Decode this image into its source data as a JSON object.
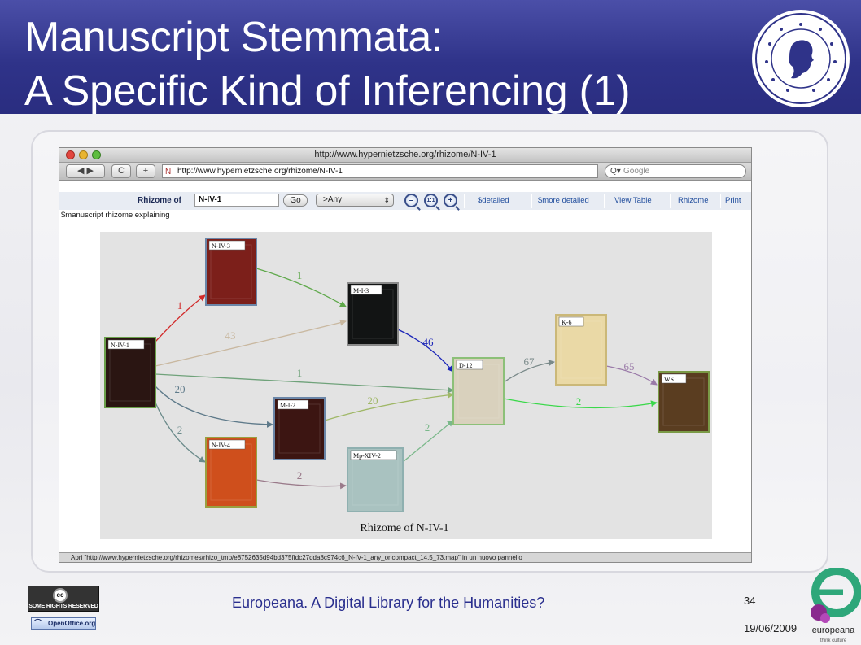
{
  "slide": {
    "title_line1": "Manuscript Stemmata:",
    "title_line2": "A Specific Kind of Inferencing (1)",
    "footer_text": "Europeana. A Digital Library for the Humanities?",
    "page_number": "34",
    "date": "19/06/2009",
    "cc_label": "SOME RIGHTS RESERVED",
    "openoffice_label": "OpenOffice.org",
    "europeana_logo_label": "europeana",
    "europeana_logo_sublabel": "think culture"
  },
  "browser": {
    "window_title": "http://www.hypernietzsche.org/rhizome/N-IV-1",
    "back_forward": "◀ ▶",
    "reload": "C",
    "add": "+",
    "url": "http://www.hypernietzsche.org/rhizome/N-IV-1",
    "search_placeholder": "Google",
    "status_bar": "Apri \"http://www.hypernietzsche.org/rhizomes/rhizo_tmp/e8752635d94bd375ffdc27dda8c974c6_N-IV-1_any_oncompact_14.5_73.map\" in un nuovo pannello"
  },
  "page": {
    "rhizome_label": "Rhizome of",
    "rhizome_value": "N-IV-1",
    "go_label": "Go",
    "filter_value": ">Any",
    "zoom_out": "–",
    "zoom_reset": "1:1",
    "zoom_in": "+",
    "nav_links": [
      "$detailed",
      "$more detailed",
      "View Table",
      "Rhizome",
      "Print"
    ],
    "explain_text": "$manuscript rhizome explaining"
  },
  "graph": {
    "caption": "Rhizome of N-IV-1",
    "nodes": [
      {
        "id": "N-IV-1",
        "cover": "#2a1512",
        "border": "#6aa04a"
      },
      {
        "id": "N-IV-3",
        "cover": "#7c1f1a",
        "border": "#6b86a8"
      },
      {
        "id": "M-I-3",
        "cover": "#121414",
        "border": "#8a8a8a"
      },
      {
        "id": "M-I-2",
        "cover": "#3c1512",
        "border": "#6b86a8"
      },
      {
        "id": "N-IV-4",
        "cover": "#cf4f1c",
        "border": "#9aa040"
      },
      {
        "id": "Mp-XIV-2",
        "cover": "#a9c2c0",
        "border": "#8fb0b0"
      },
      {
        "id": "D-12",
        "cover": "#d9d1bd",
        "border": "#8cc078"
      },
      {
        "id": "K-6",
        "cover": "#ead9a6",
        "border": "#cbb878"
      },
      {
        "id": "WS",
        "cover": "#5a3d20",
        "border": "#7a9a46"
      }
    ],
    "edges": [
      {
        "from": "N-IV-1",
        "to": "N-IV-3",
        "label": "1",
        "color": "#d22a2a"
      },
      {
        "from": "N-IV-3",
        "to": "M-I-3",
        "label": "1",
        "color": "#5ea84a"
      },
      {
        "from": "N-IV-1",
        "to": "M-I-3",
        "label": "43",
        "color": "#c9b8a0"
      },
      {
        "from": "M-I-3",
        "to": "D-12",
        "label": "46",
        "color": "#1a24b8"
      },
      {
        "from": "N-IV-1",
        "to": "D-12",
        "label": "1",
        "color": "#6fa27a"
      },
      {
        "from": "N-IV-1",
        "to": "M-I-2",
        "label": "20",
        "color": "#5e7a8a"
      },
      {
        "from": "M-I-2",
        "to": "D-12",
        "label": "20",
        "color": "#a0b868"
      },
      {
        "from": "N-IV-1",
        "to": "N-IV-4",
        "label": "2",
        "color": "#6a8a8a"
      },
      {
        "from": "N-IV-4",
        "to": "Mp-XIV-2",
        "label": "2",
        "color": "#9a7a8a"
      },
      {
        "from": "Mp-XIV-2",
        "to": "D-12",
        "label": "2",
        "color": "#7ab88a"
      },
      {
        "from": "D-12",
        "to": "K-6",
        "label": "67",
        "color": "#7a8a8a"
      },
      {
        "from": "D-12",
        "to": "WS",
        "label": "2",
        "color": "#3ad84a"
      },
      {
        "from": "K-6",
        "to": "WS",
        "label": "65",
        "color": "#9a7aa8"
      }
    ]
  },
  "colors": {
    "title_bar": "#2f3389",
    "footer_text": "#2a2f8e",
    "nav_link": "#1f4c9c"
  }
}
